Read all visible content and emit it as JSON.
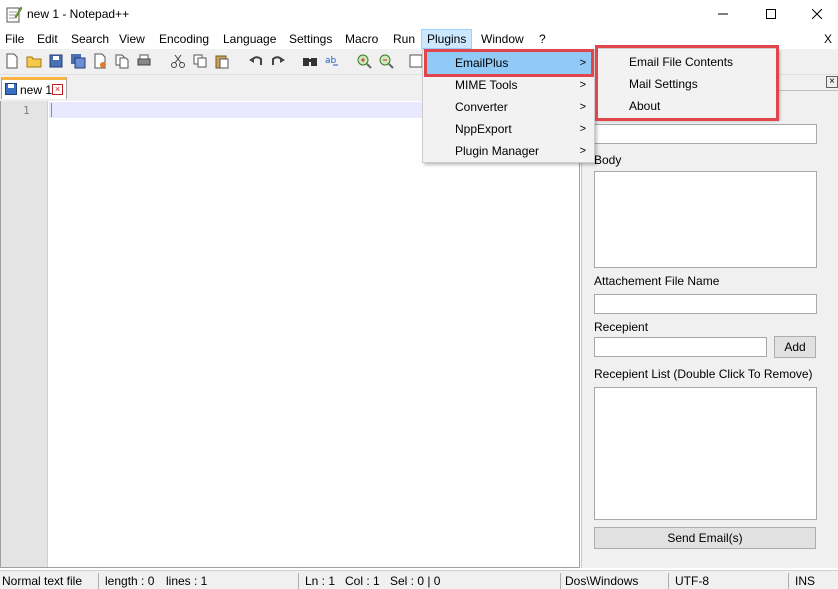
{
  "window": {
    "title": "new 1 - Notepad++",
    "minimize": "—",
    "maximize": "☐",
    "close": "✕"
  },
  "menubar": {
    "items": [
      "File",
      "Edit",
      "Search",
      "View",
      "Encoding",
      "Language",
      "Settings",
      "Macro",
      "Run",
      "Plugins",
      "Window",
      "?"
    ],
    "close_doc": "X"
  },
  "tab": {
    "label": "new 1",
    "close": "×"
  },
  "editor": {
    "line_number": "1"
  },
  "plugins_menu": {
    "items": [
      {
        "label": "EmailPlus",
        "arrow": ">"
      },
      {
        "label": "MIME Tools",
        "arrow": ">"
      },
      {
        "label": "Converter",
        "arrow": ">"
      },
      {
        "label": "NppExport",
        "arrow": ">"
      },
      {
        "label": "Plugin Manager",
        "arrow": ">"
      }
    ]
  },
  "emailplus_submenu": {
    "items": [
      "Email File Contents",
      "Mail Settings",
      "About"
    ]
  },
  "panel": {
    "close": "×",
    "body_label": "Body",
    "attachment_label": "Attachement File Name",
    "recipient_label": "Recepient",
    "add_button": "Add",
    "recipient_list_label": "Recepient List (Double Click To Remove)",
    "send_button": "Send Email(s)"
  },
  "statusbar": {
    "file_type": "Normal text file",
    "length": "length : 0",
    "lines": "lines : 1",
    "ln": "Ln : 1",
    "col": "Col : 1",
    "sel": "Sel : 0 | 0",
    "eol": "Dos\\Windows",
    "encoding": "UTF-8",
    "mode": "INS"
  },
  "colors": {
    "highlight": "#91c9f7",
    "callout_red": "#e0474c",
    "tab_accent": "#f9b544"
  }
}
